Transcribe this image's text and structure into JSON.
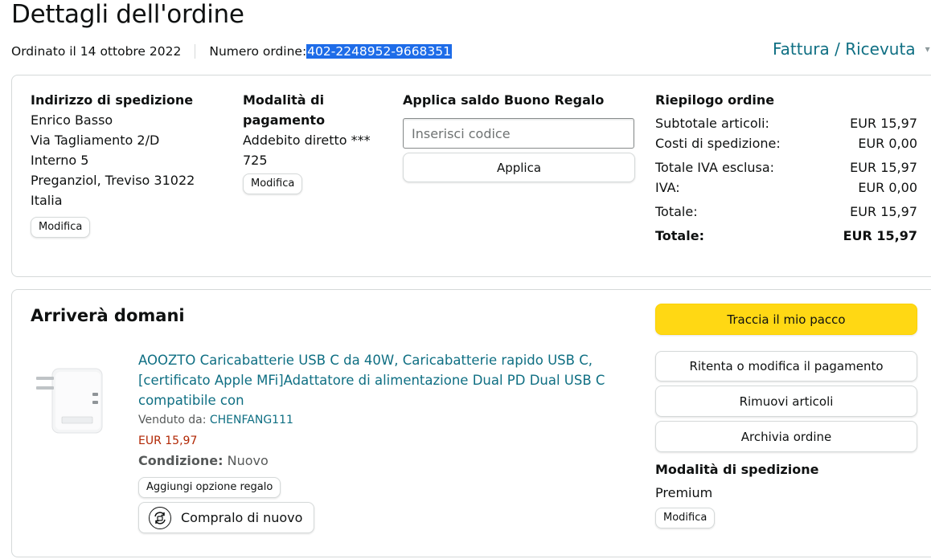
{
  "header": {
    "title": "Dettagli dell'ordine",
    "ordered_on": "Ordinato il 14 ottobre 2022",
    "order_number_label": "Numero ordine: ",
    "order_number": "402-2248952-9668351",
    "invoice_link": "Fattura / Ricevuta"
  },
  "shipping_address": {
    "title": "Indirizzo di spedizione",
    "lines": [
      "Enrico Basso",
      "Via Tagliamento 2/D",
      "Interno 5",
      "Preganziol, Treviso 31022",
      "Italia"
    ],
    "edit_label": "Modifica"
  },
  "payment": {
    "title_line1": "Modalità di",
    "title_line2": "pagamento",
    "method_line1": "Addebito diretto ***",
    "method_line2": "725",
    "edit_label": "Modifica"
  },
  "gift_card": {
    "title": "Applica saldo Buono Regalo",
    "placeholder": "Inserisci codice",
    "apply_label": "Applica"
  },
  "summary": {
    "title": "Riepilogo ordine",
    "rows": [
      {
        "label": "Subtotale articoli:",
        "value": "EUR 15,97"
      },
      {
        "label": "Costi di spedizione:",
        "value": "EUR 0,00"
      },
      {
        "label": "Totale IVA esclusa:",
        "value": "EUR 15,97"
      },
      {
        "label": "IVA:",
        "value": "EUR 0,00"
      },
      {
        "label": "Totale:",
        "value": "EUR 15,97"
      },
      {
        "label": "Totale:",
        "value": "EUR 15,97"
      }
    ]
  },
  "shipment": {
    "title": "Arriverà domani",
    "product": {
      "title": "AOOZTO Caricabatterie USB C da 40W, Caricabatterie rapido USB C, [certificato Apple MFi]Adattatore di alimentazione Dual PD Dual USB C compatibile con",
      "sold_by_label": "Venduto da: ",
      "seller": "CHENFANG111",
      "price": "EUR 15,97",
      "condition_label": "Condizione:",
      "condition_value": "Nuovo",
      "gift_option_label": "Aggiungi opzione regalo",
      "buy_again_label": "Compralo di nuovo"
    },
    "actions": {
      "track": "Traccia il mio pacco",
      "retry_payment": "Ritenta o modifica il pagamento",
      "remove_items": "Rimuovi articoli",
      "archive": "Archivia ordine"
    },
    "shipping_method": {
      "title": "Modalità di spedizione",
      "value": "Premium",
      "edit_label": "Modifica"
    }
  },
  "colors": {
    "link": "#0f6f83",
    "price": "#b12704",
    "primary_button": "#ffd814",
    "selection": "#1e6ce8"
  },
  "icons": {
    "invoice_dropdown": "chevron-down-icon",
    "buy_again": "buy-again-icon"
  }
}
